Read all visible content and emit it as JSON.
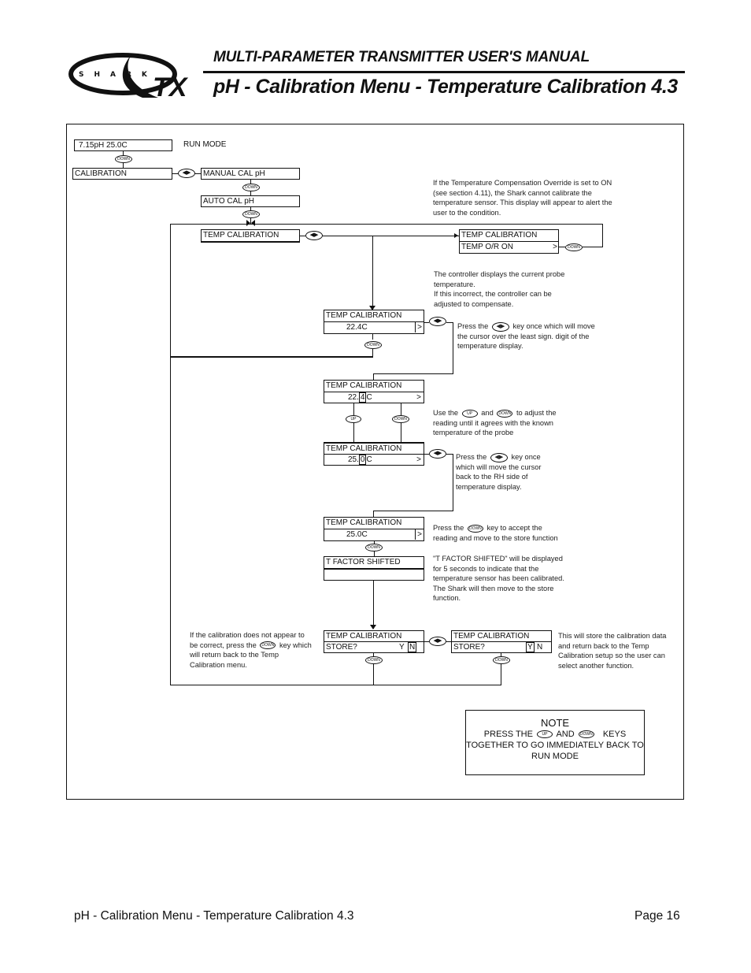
{
  "header": {
    "logo": {
      "word": "SHARK",
      "suffix": "TX"
    },
    "subtitle": "MULTI-PARAMETER TRANSMITTER USER'S MANUAL",
    "title": "pH - Calibration Menu - Temperature Calibration 4.3"
  },
  "keys": {
    "down": "DOWN",
    "up": "UP",
    "leftright": "◀▶"
  },
  "displays": {
    "run": {
      "line1": "7.15pH   25.0C",
      "label": "RUN MODE"
    },
    "calibration": "CALIBRATION",
    "manual_cal": "MANUAL CAL pH",
    "auto_cal": "AUTO CAL pH",
    "temp_cal_menu": "TEMP CALIBRATION",
    "override": {
      "line1": "TEMP CALIBRATION",
      "line2": "TEMP O/R ON",
      "arrow": ">"
    },
    "current": {
      "line1": "TEMP CALIBRATION",
      "line2": "22.4C",
      "arrow": ">"
    },
    "edit1": {
      "line1": "TEMP CALIBRATION",
      "value_prefix": "22.",
      "cursor_digit": "4",
      "value_suffix": "C",
      "arrow": ">"
    },
    "edit2": {
      "line1": "TEMP CALIBRATION",
      "value_prefix": "25.",
      "cursor_digit": "0",
      "value_suffix": "C",
      "arrow": ">"
    },
    "accept": {
      "line1": "TEMP CALIBRATION",
      "line2": "25.0C",
      "arrow": ">"
    },
    "shifted": {
      "line1": "T FACTOR SHIFTED",
      "line2": ""
    },
    "store_n": {
      "line1": "TEMP CALIBRATION",
      "line2": "STORE?",
      "yes": "Y",
      "no": "N"
    },
    "store_y": {
      "line1": "TEMP CALIBRATION",
      "line2": "STORE?",
      "yes": "Y",
      "no": "N"
    }
  },
  "notes": {
    "override": "If the Temperature Compensation Override is set to ON (see section 4.11), the Shark cannot calibrate the temperature sensor. This display will appear to alert the user to the condition.",
    "current": "The controller displays the current probe temperature.\nIf this incorrect, the controller can be adjusted to compensate.",
    "move_cursor": {
      "pre": "Press the",
      "post": "key once which will move the cursor over the least sign. digit of the temperature display."
    },
    "adjust": {
      "pre": "Use the",
      "mid": "and",
      "post": "to adjust the reading until it agrees with the known temperature of the probe"
    },
    "move_back": {
      "pre": "Press the",
      "post": "key once which will move the cursor back to the RH side of temperature display."
    },
    "accept": {
      "pre": "Press the",
      "post": "key to accept the reading and move to the store function"
    },
    "shifted": "\"T FACTOR SHIFTED\" will be displayed for 5 seconds to indicate that the temperature sensor has been calibrated.\nThe Shark will then move to the store function.",
    "not_correct": {
      "pre": "If the calibration does not appear to be correct, press the",
      "post": "key which will return back to the Temp Calibration menu."
    },
    "store": "This will store the calibration data and return back to the Temp Calibration   setup so the user can select another function."
  },
  "notebox": {
    "title": "NOTE",
    "line1_pre": "PRESS THE",
    "line1_mid": "AND",
    "line1_post": "KEYS",
    "line2": "TOGETHER TO GO IMMEDIATELY BACK TO",
    "line3": "RUN MODE"
  },
  "footer": {
    "left": "pH - Calibration Menu - Temperature Calibration 4.3",
    "right": "Page 16"
  }
}
